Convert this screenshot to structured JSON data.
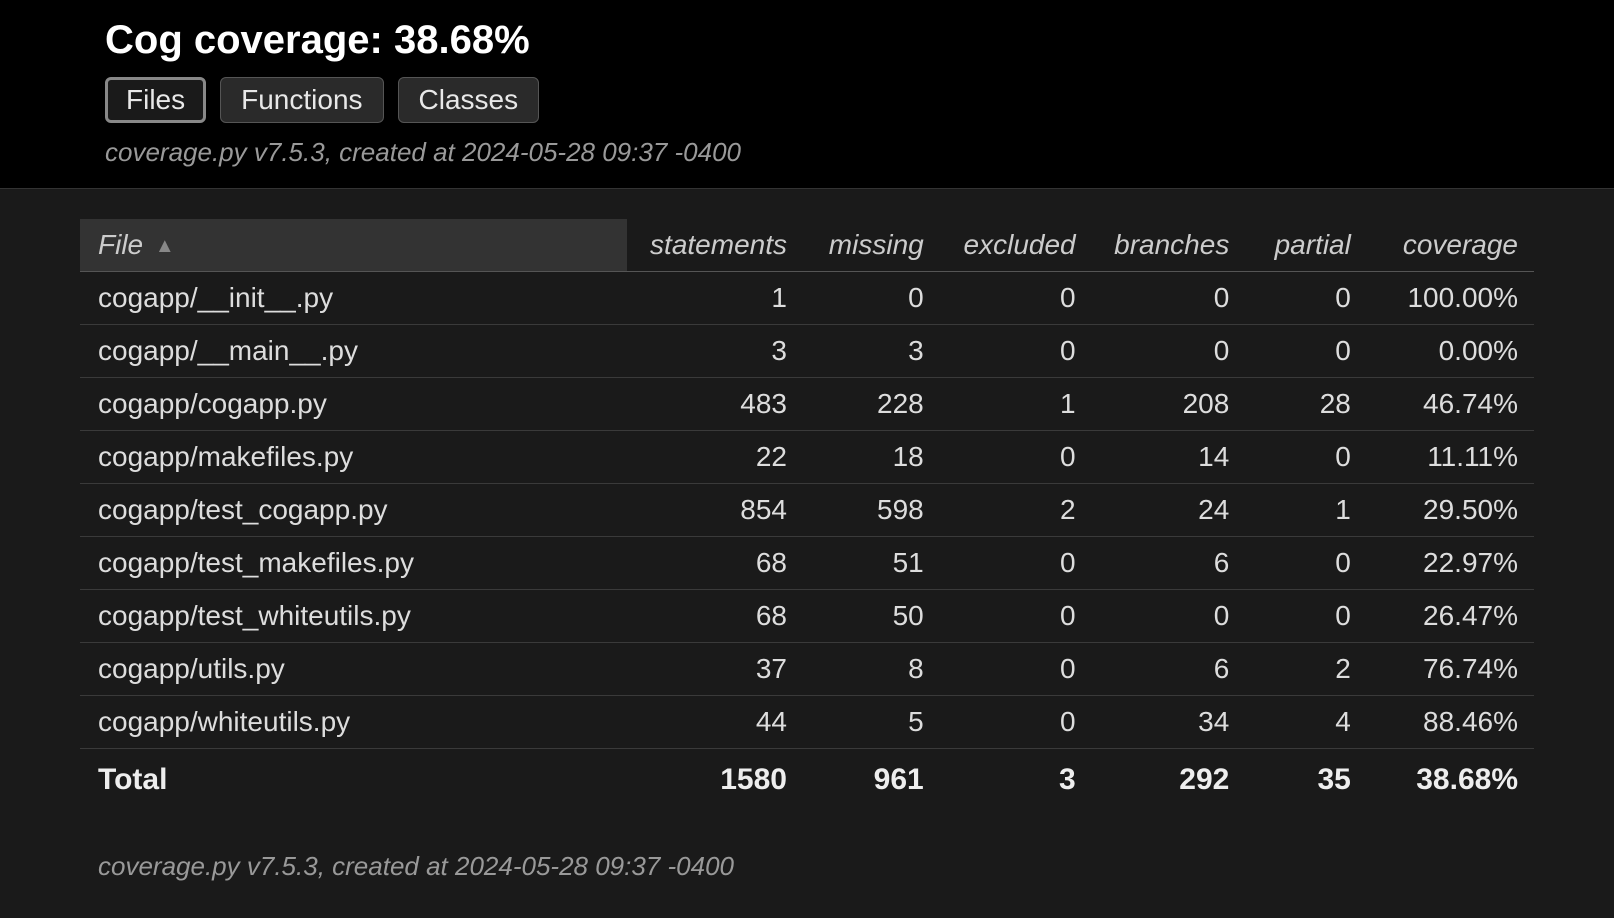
{
  "header": {
    "title": "Cog coverage: 38.68%",
    "tabs": {
      "files": "Files",
      "functions": "Functions",
      "classes": "Classes"
    },
    "meta": "coverage.py v7.5.3, created at 2024-05-28 09:37 -0400"
  },
  "columns": {
    "file": "File",
    "statements": "statements",
    "missing": "missing",
    "excluded": "excluded",
    "branches": "branches",
    "partial": "partial",
    "coverage": "coverage"
  },
  "rows": [
    {
      "file": "cogapp/__init__.py",
      "statements": "1",
      "missing": "0",
      "excluded": "0",
      "branches": "0",
      "partial": "0",
      "coverage": "100.00%"
    },
    {
      "file": "cogapp/__main__.py",
      "statements": "3",
      "missing": "3",
      "excluded": "0",
      "branches": "0",
      "partial": "0",
      "coverage": "0.00%"
    },
    {
      "file": "cogapp/cogapp.py",
      "statements": "483",
      "missing": "228",
      "excluded": "1",
      "branches": "208",
      "partial": "28",
      "coverage": "46.74%"
    },
    {
      "file": "cogapp/makefiles.py",
      "statements": "22",
      "missing": "18",
      "excluded": "0",
      "branches": "14",
      "partial": "0",
      "coverage": "11.11%"
    },
    {
      "file": "cogapp/test_cogapp.py",
      "statements": "854",
      "missing": "598",
      "excluded": "2",
      "branches": "24",
      "partial": "1",
      "coverage": "29.50%"
    },
    {
      "file": "cogapp/test_makefiles.py",
      "statements": "68",
      "missing": "51",
      "excluded": "0",
      "branches": "6",
      "partial": "0",
      "coverage": "22.97%"
    },
    {
      "file": "cogapp/test_whiteutils.py",
      "statements": "68",
      "missing": "50",
      "excluded": "0",
      "branches": "0",
      "partial": "0",
      "coverage": "26.47%"
    },
    {
      "file": "cogapp/utils.py",
      "statements": "37",
      "missing": "8",
      "excluded": "0",
      "branches": "6",
      "partial": "2",
      "coverage": "76.74%"
    },
    {
      "file": "cogapp/whiteutils.py",
      "statements": "44",
      "missing": "5",
      "excluded": "0",
      "branches": "34",
      "partial": "4",
      "coverage": "88.46%"
    }
  ],
  "total": {
    "label": "Total",
    "statements": "1580",
    "missing": "961",
    "excluded": "3",
    "branches": "292",
    "partial": "35",
    "coverage": "38.68%"
  },
  "footer_meta": "coverage.py v7.5.3, created at 2024-05-28 09:37 -0400"
}
